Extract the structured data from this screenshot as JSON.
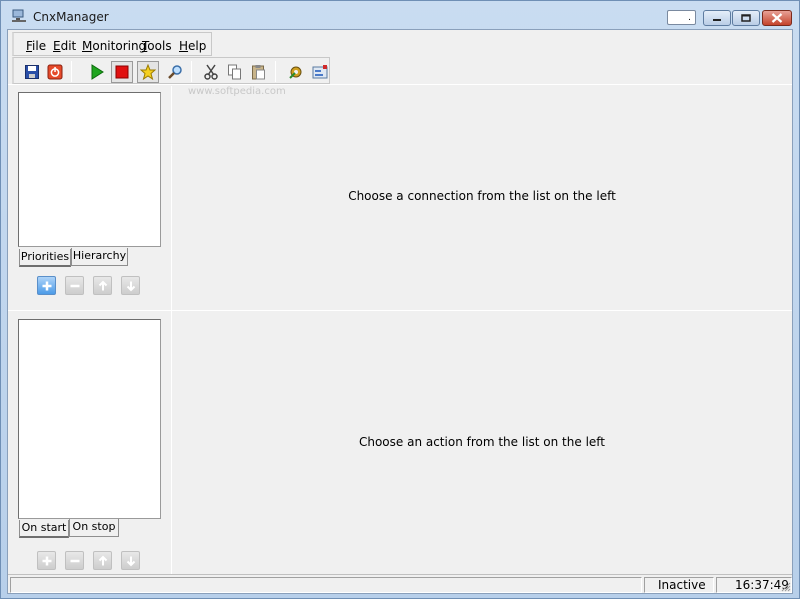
{
  "window": {
    "title": "CnxManager",
    "icon": "network-computer-icon"
  },
  "menu": {
    "items": [
      {
        "accel": "F",
        "rest": "ile"
      },
      {
        "accel": "E",
        "rest": "dit"
      },
      {
        "accel": "M",
        "rest": "onitoring"
      },
      {
        "accel": "T",
        "rest": "ools"
      },
      {
        "accel": "H",
        "rest": "elp"
      }
    ]
  },
  "toolbar": {
    "buttons": [
      "save-icon",
      "disconnect-icon",
      "start-icon",
      "stop-icon",
      "favorite-icon",
      "search-icon",
      "cut-icon",
      "copy-icon",
      "paste-icon",
      "options-icon",
      "properties-icon"
    ]
  },
  "watermark": "www.softpedia.com",
  "connections_pane": {
    "tabs": [
      "Priorities",
      "Hierarchy"
    ],
    "message": "Choose a connection from the list on the left"
  },
  "actions_pane": {
    "tabs": [
      "On start",
      "On stop"
    ],
    "message": "Choose an action from the list on the left"
  },
  "statusbar": {
    "state": "Inactive",
    "clock": "16:37:49"
  },
  "colors": {
    "start_green": "#1fa51f",
    "stop_red": "#e01010",
    "add_blue": "#4c9be8"
  }
}
